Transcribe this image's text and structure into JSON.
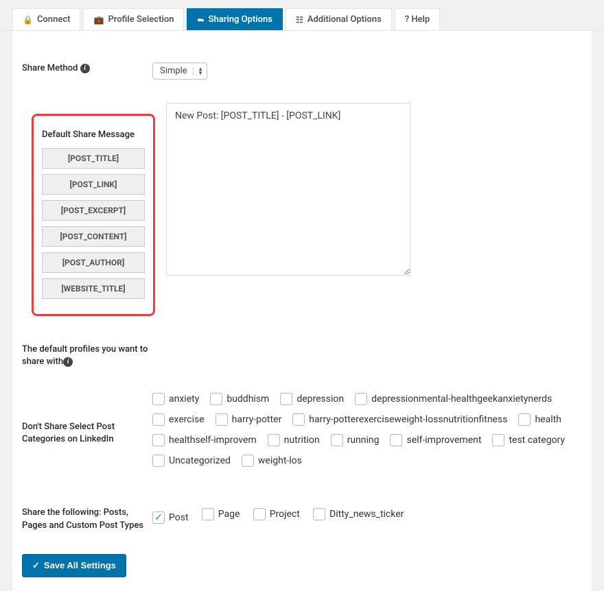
{
  "tabs": {
    "connect": "Connect",
    "profile": "Profile Selection",
    "sharing": "Sharing Options",
    "additional": "Additional Options",
    "help": "? Help"
  },
  "share_method": {
    "label": "Share Method",
    "value": "Simple"
  },
  "default_msg": {
    "label": "Default Share Message",
    "tokens": [
      "[POST_TITLE]",
      "[POST_LINK]",
      "[POST_EXCERPT]",
      "[POST_CONTENT]",
      "[POST_AUTHOR]",
      "[WEBSITE_TITLE]"
    ],
    "value": "New Post: [POST_TITLE] - [POST_LINK]"
  },
  "profiles": {
    "label": "The default profiles you want to share with"
  },
  "categories": {
    "label": "Don't Share Select Post Categories on LinkedIn",
    "items": [
      "anxiety",
      "buddhism",
      "depression",
      "depressionmental-healthgeekanxietynerds",
      "exercise",
      "harry-potter",
      "harry-potterexerciseweight-lossnutritionfitness",
      "health",
      "healthself-improvem",
      "nutrition",
      "running",
      "self-improvement",
      "test category",
      "Uncategorized",
      "weight-los"
    ]
  },
  "post_types": {
    "label": "Share the following: Posts, Pages and Custom Post Types",
    "items": [
      {
        "label": "Post",
        "checked": true
      },
      {
        "label": "Page",
        "checked": false
      },
      {
        "label": "Project",
        "checked": false
      },
      {
        "label": "Ditty_news_ticker",
        "checked": false
      }
    ]
  },
  "save_label": "Save All Settings"
}
